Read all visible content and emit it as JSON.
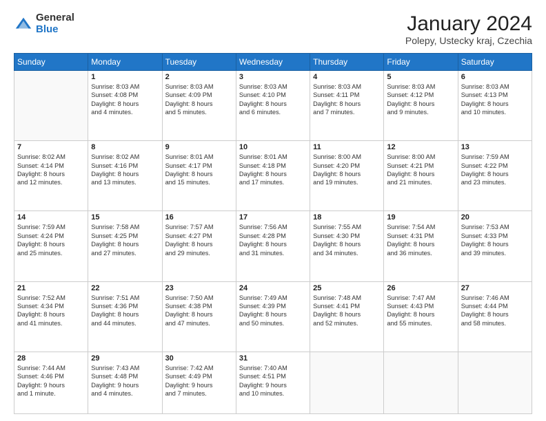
{
  "logo": {
    "general": "General",
    "blue": "Blue"
  },
  "header": {
    "month": "January 2024",
    "location": "Polepy, Ustecky kraj, Czechia"
  },
  "weekdays": [
    "Sunday",
    "Monday",
    "Tuesday",
    "Wednesday",
    "Thursday",
    "Friday",
    "Saturday"
  ],
  "weeks": [
    [
      {
        "day": "",
        "info": ""
      },
      {
        "day": "1",
        "info": "Sunrise: 8:03 AM\nSunset: 4:08 PM\nDaylight: 8 hours\nand 4 minutes."
      },
      {
        "day": "2",
        "info": "Sunrise: 8:03 AM\nSunset: 4:09 PM\nDaylight: 8 hours\nand 5 minutes."
      },
      {
        "day": "3",
        "info": "Sunrise: 8:03 AM\nSunset: 4:10 PM\nDaylight: 8 hours\nand 6 minutes."
      },
      {
        "day": "4",
        "info": "Sunrise: 8:03 AM\nSunset: 4:11 PM\nDaylight: 8 hours\nand 7 minutes."
      },
      {
        "day": "5",
        "info": "Sunrise: 8:03 AM\nSunset: 4:12 PM\nDaylight: 8 hours\nand 9 minutes."
      },
      {
        "day": "6",
        "info": "Sunrise: 8:03 AM\nSunset: 4:13 PM\nDaylight: 8 hours\nand 10 minutes."
      }
    ],
    [
      {
        "day": "7",
        "info": "Sunrise: 8:02 AM\nSunset: 4:14 PM\nDaylight: 8 hours\nand 12 minutes."
      },
      {
        "day": "8",
        "info": "Sunrise: 8:02 AM\nSunset: 4:16 PM\nDaylight: 8 hours\nand 13 minutes."
      },
      {
        "day": "9",
        "info": "Sunrise: 8:01 AM\nSunset: 4:17 PM\nDaylight: 8 hours\nand 15 minutes."
      },
      {
        "day": "10",
        "info": "Sunrise: 8:01 AM\nSunset: 4:18 PM\nDaylight: 8 hours\nand 17 minutes."
      },
      {
        "day": "11",
        "info": "Sunrise: 8:00 AM\nSunset: 4:20 PM\nDaylight: 8 hours\nand 19 minutes."
      },
      {
        "day": "12",
        "info": "Sunrise: 8:00 AM\nSunset: 4:21 PM\nDaylight: 8 hours\nand 21 minutes."
      },
      {
        "day": "13",
        "info": "Sunrise: 7:59 AM\nSunset: 4:22 PM\nDaylight: 8 hours\nand 23 minutes."
      }
    ],
    [
      {
        "day": "14",
        "info": "Sunrise: 7:59 AM\nSunset: 4:24 PM\nDaylight: 8 hours\nand 25 minutes."
      },
      {
        "day": "15",
        "info": "Sunrise: 7:58 AM\nSunset: 4:25 PM\nDaylight: 8 hours\nand 27 minutes."
      },
      {
        "day": "16",
        "info": "Sunrise: 7:57 AM\nSunset: 4:27 PM\nDaylight: 8 hours\nand 29 minutes."
      },
      {
        "day": "17",
        "info": "Sunrise: 7:56 AM\nSunset: 4:28 PM\nDaylight: 8 hours\nand 31 minutes."
      },
      {
        "day": "18",
        "info": "Sunrise: 7:55 AM\nSunset: 4:30 PM\nDaylight: 8 hours\nand 34 minutes."
      },
      {
        "day": "19",
        "info": "Sunrise: 7:54 AM\nSunset: 4:31 PM\nDaylight: 8 hours\nand 36 minutes."
      },
      {
        "day": "20",
        "info": "Sunrise: 7:53 AM\nSunset: 4:33 PM\nDaylight: 8 hours\nand 39 minutes."
      }
    ],
    [
      {
        "day": "21",
        "info": "Sunrise: 7:52 AM\nSunset: 4:34 PM\nDaylight: 8 hours\nand 41 minutes."
      },
      {
        "day": "22",
        "info": "Sunrise: 7:51 AM\nSunset: 4:36 PM\nDaylight: 8 hours\nand 44 minutes."
      },
      {
        "day": "23",
        "info": "Sunrise: 7:50 AM\nSunset: 4:38 PM\nDaylight: 8 hours\nand 47 minutes."
      },
      {
        "day": "24",
        "info": "Sunrise: 7:49 AM\nSunset: 4:39 PM\nDaylight: 8 hours\nand 50 minutes."
      },
      {
        "day": "25",
        "info": "Sunrise: 7:48 AM\nSunset: 4:41 PM\nDaylight: 8 hours\nand 52 minutes."
      },
      {
        "day": "26",
        "info": "Sunrise: 7:47 AM\nSunset: 4:43 PM\nDaylight: 8 hours\nand 55 minutes."
      },
      {
        "day": "27",
        "info": "Sunrise: 7:46 AM\nSunset: 4:44 PM\nDaylight: 8 hours\nand 58 minutes."
      }
    ],
    [
      {
        "day": "28",
        "info": "Sunrise: 7:44 AM\nSunset: 4:46 PM\nDaylight: 9 hours\nand 1 minute."
      },
      {
        "day": "29",
        "info": "Sunrise: 7:43 AM\nSunset: 4:48 PM\nDaylight: 9 hours\nand 4 minutes."
      },
      {
        "day": "30",
        "info": "Sunrise: 7:42 AM\nSunset: 4:49 PM\nDaylight: 9 hours\nand 7 minutes."
      },
      {
        "day": "31",
        "info": "Sunrise: 7:40 AM\nSunset: 4:51 PM\nDaylight: 9 hours\nand 10 minutes."
      },
      {
        "day": "",
        "info": ""
      },
      {
        "day": "",
        "info": ""
      },
      {
        "day": "",
        "info": ""
      }
    ]
  ]
}
